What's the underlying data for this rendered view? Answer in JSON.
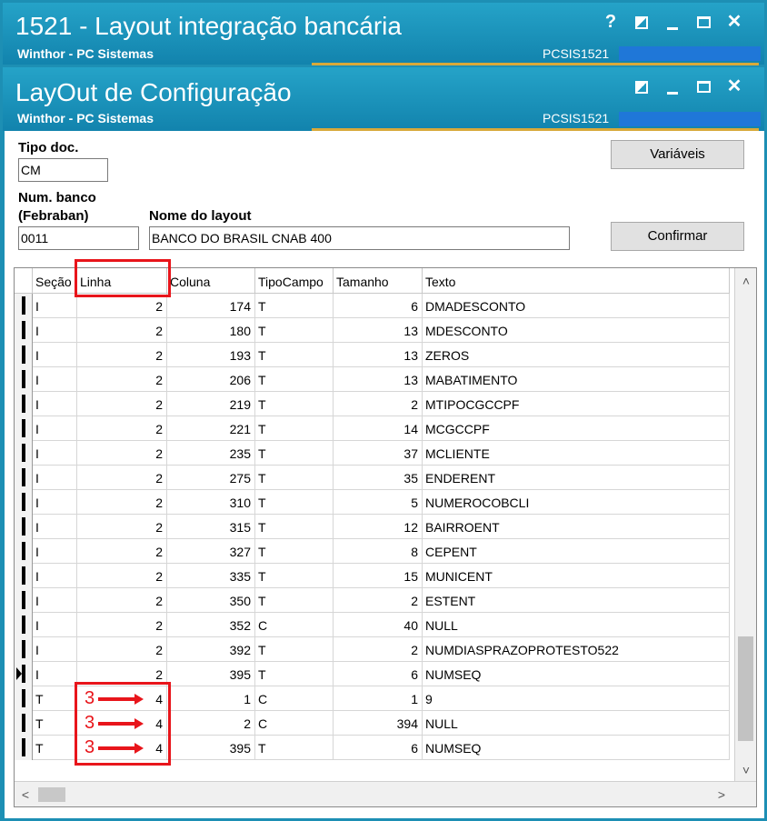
{
  "window1": {
    "title": "1521 - Layout integração bancária",
    "subtitle": "Winthor - PC Sistemas",
    "code": "PCSIS1521",
    "help": "?",
    "close": "✕"
  },
  "window2": {
    "title": "LayOut de Configuração",
    "subtitle": "Winthor - PC Sistemas",
    "code": "PCSIS1521",
    "close": "✕"
  },
  "form": {
    "tipo_doc_label": "Tipo doc.",
    "tipo_doc_value": "CM",
    "num_banco_label_1": "Num. banco",
    "num_banco_label_2": "(Febraban)",
    "num_banco_value": "0011",
    "nome_layout_label": "Nome do layout",
    "nome_layout_value": "BANCO DO BRASIL CNAB 400",
    "variaveis_button": "Variáveis",
    "confirmar_button": "Confirmar"
  },
  "grid": {
    "columns": [
      "Seção",
      "Linha",
      "Coluna",
      "TipoCampo",
      "Tamanho",
      "Texto"
    ],
    "rows": [
      [
        "I",
        "2",
        "174",
        "T",
        "6",
        "DMADESCONTO"
      ],
      [
        "I",
        "2",
        "180",
        "T",
        "13",
        "MDESCONTO"
      ],
      [
        "I",
        "2",
        "193",
        "T",
        "13",
        "ZEROS"
      ],
      [
        "I",
        "2",
        "206",
        "T",
        "13",
        "MABATIMENTO"
      ],
      [
        "I",
        "2",
        "219",
        "T",
        "2",
        "MTIPOCGCCPF"
      ],
      [
        "I",
        "2",
        "221",
        "T",
        "14",
        "MCGCCPF"
      ],
      [
        "I",
        "2",
        "235",
        "T",
        "37",
        "MCLIENTE"
      ],
      [
        "I",
        "2",
        "275",
        "T",
        "35",
        "ENDERENT"
      ],
      [
        "I",
        "2",
        "310",
        "T",
        "5",
        "NUMEROCOBCLI"
      ],
      [
        "I",
        "2",
        "315",
        "T",
        "12",
        "BAIRROENT"
      ],
      [
        "I",
        "2",
        "327",
        "T",
        "8",
        "CEPENT"
      ],
      [
        "I",
        "2",
        "335",
        "T",
        "15",
        "MUNICENT"
      ],
      [
        "I",
        "2",
        "350",
        "T",
        "2",
        "ESTENT"
      ],
      [
        "I",
        "2",
        "352",
        "C",
        "40",
        "NULL"
      ],
      [
        "I",
        "2",
        "392",
        "T",
        "2",
        "NUMDIASPRAZOPROTESTO522"
      ],
      [
        "I",
        "2",
        "395",
        "T",
        "6",
        "NUMSEQ"
      ],
      [
        "T",
        "4",
        "1",
        "C",
        "1",
        "9"
      ],
      [
        "T",
        "4",
        "2",
        "C",
        "394",
        "NULL"
      ],
      [
        "T",
        "4",
        "395",
        "T",
        "6",
        "NUMSEQ"
      ]
    ],
    "current_row": 15
  },
  "annotations": {
    "step_number": "3",
    "color": "#e8151b"
  },
  "colors": {
    "titlebar": "#1d8fb4",
    "accent_gold": "#d8a93a",
    "code_bar": "#1f77d8"
  },
  "icons": [
    "help-icon",
    "restore-icon",
    "minimize-icon",
    "maximize-icon",
    "close-icon",
    "row-pointer-icon",
    "scroll-up-icon",
    "scroll-down-icon",
    "scroll-left-icon",
    "scroll-right-icon",
    "arrow-right-icon"
  ]
}
